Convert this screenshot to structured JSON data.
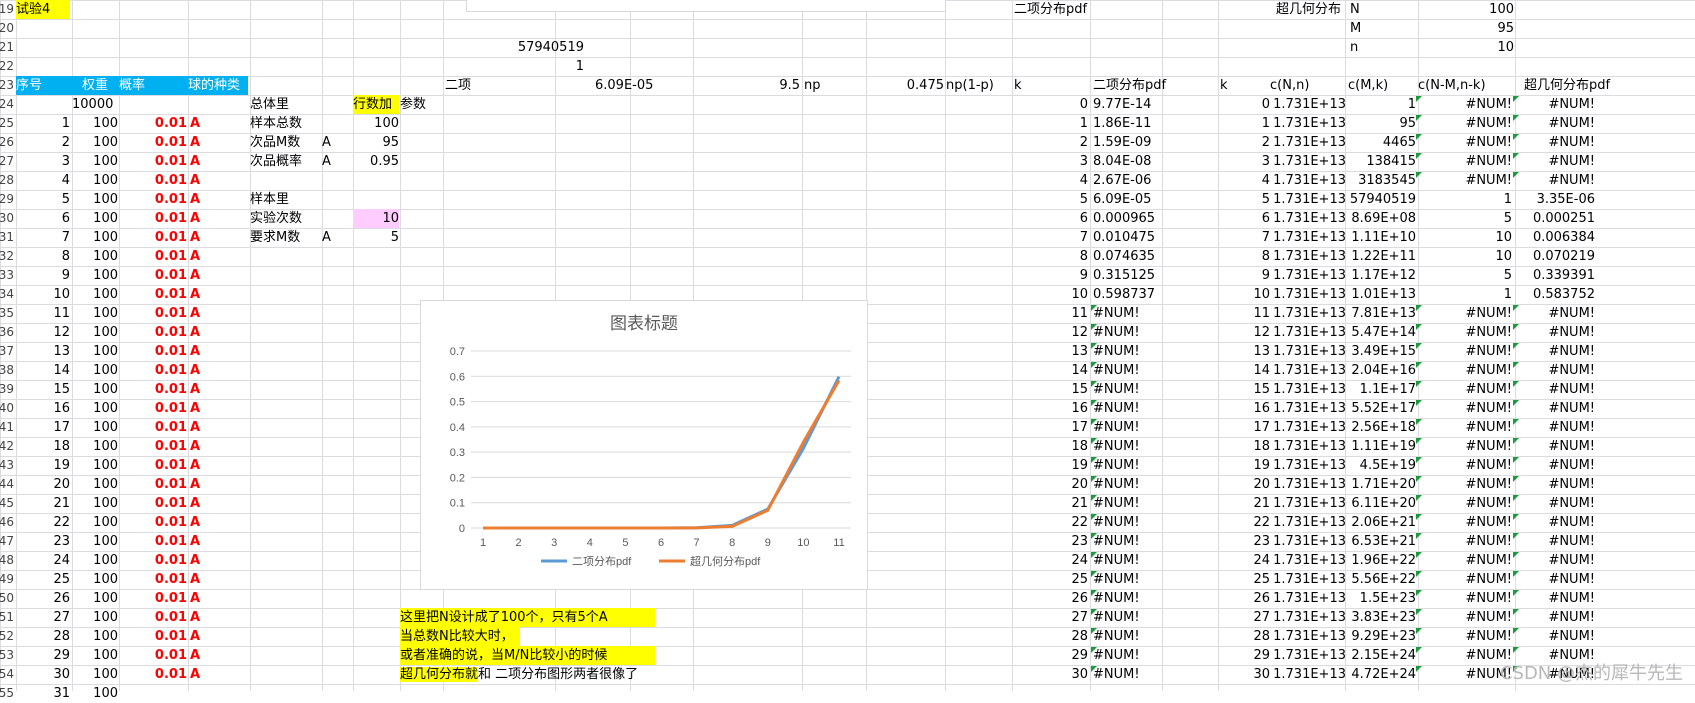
{
  "row_numbers": [
    "19",
    "20",
    "21",
    "22",
    "23",
    "24",
    "25",
    "26",
    "27",
    "28",
    "29",
    "30",
    "31",
    "32",
    "33",
    "34",
    "35",
    "36",
    "37",
    "38",
    "39",
    "40",
    "41",
    "42",
    "43",
    "44",
    "45",
    "46",
    "47",
    "48",
    "49",
    "50",
    "51",
    "52",
    "53",
    "54",
    "55"
  ],
  "title_cell": "试验4",
  "mid_top": {
    "big_number": "57940519",
    "one": "1"
  },
  "header_row": {
    "seq": "序号",
    "weight": "权重",
    "prob": "概率",
    "kind": "球的种类",
    "binom_label": "二项",
    "binom_val": "6.09E-05",
    "np_val": "9.5",
    "np_label": "np",
    "npq_val": "0.475",
    "npq_label": "np(1-p)"
  },
  "left_table": {
    "total_weight": "10000",
    "rows": [
      {
        "n": "1",
        "w": "100",
        "p": "0.01",
        "k": "A"
      },
      {
        "n": "2",
        "w": "100",
        "p": "0.01",
        "k": "A"
      },
      {
        "n": "3",
        "w": "100",
        "p": "0.01",
        "k": "A"
      },
      {
        "n": "4",
        "w": "100",
        "p": "0.01",
        "k": "A"
      },
      {
        "n": "5",
        "w": "100",
        "p": "0.01",
        "k": "A"
      },
      {
        "n": "6",
        "w": "100",
        "p": "0.01",
        "k": "A"
      },
      {
        "n": "7",
        "w": "100",
        "p": "0.01",
        "k": "A"
      },
      {
        "n": "8",
        "w": "100",
        "p": "0.01",
        "k": "A"
      },
      {
        "n": "9",
        "w": "100",
        "p": "0.01",
        "k": "A"
      },
      {
        "n": "10",
        "w": "100",
        "p": "0.01",
        "k": "A"
      },
      {
        "n": "11",
        "w": "100",
        "p": "0.01",
        "k": "A"
      },
      {
        "n": "12",
        "w": "100",
        "p": "0.01",
        "k": "A"
      },
      {
        "n": "13",
        "w": "100",
        "p": "0.01",
        "k": "A"
      },
      {
        "n": "14",
        "w": "100",
        "p": "0.01",
        "k": "A"
      },
      {
        "n": "15",
        "w": "100",
        "p": "0.01",
        "k": "A"
      },
      {
        "n": "16",
        "w": "100",
        "p": "0.01",
        "k": "A"
      },
      {
        "n": "17",
        "w": "100",
        "p": "0.01",
        "k": "A"
      },
      {
        "n": "18",
        "w": "100",
        "p": "0.01",
        "k": "A"
      },
      {
        "n": "19",
        "w": "100",
        "p": "0.01",
        "k": "A"
      },
      {
        "n": "20",
        "w": "100",
        "p": "0.01",
        "k": "A"
      },
      {
        "n": "21",
        "w": "100",
        "p": "0.01",
        "k": "A"
      },
      {
        "n": "22",
        "w": "100",
        "p": "0.01",
        "k": "A"
      },
      {
        "n": "23",
        "w": "100",
        "p": "0.01",
        "k": "A"
      },
      {
        "n": "24",
        "w": "100",
        "p": "0.01",
        "k": "A"
      },
      {
        "n": "25",
        "w": "100",
        "p": "0.01",
        "k": "A"
      },
      {
        "n": "26",
        "w": "100",
        "p": "0.01",
        "k": "A"
      },
      {
        "n": "27",
        "w": "100",
        "p": "0.01",
        "k": "A"
      },
      {
        "n": "28",
        "w": "100",
        "p": "0.01",
        "k": "A"
      },
      {
        "n": "29",
        "w": "100",
        "p": "0.01",
        "k": "A"
      },
      {
        "n": "30",
        "w": "100",
        "p": "0.01",
        "k": "A"
      },
      {
        "n": "31",
        "w": "100",
        "p": "",
        "k": ""
      }
    ]
  },
  "params": {
    "overall": "总体里",
    "add_rows": "行数加",
    "param": "参数",
    "sample_total": "样本总数",
    "sample_total_val": "100",
    "defect_m": "次品M数",
    "defect_m_a": "A",
    "defect_m_val": "95",
    "defect_p": "次品概率",
    "defect_p_a": "A",
    "defect_p_val": "0.95",
    "in_sample": "样本里",
    "trials": "实验次数",
    "trials_val": "10",
    "req_m": "要求M数",
    "req_m_a": "A",
    "req_m_val": "5"
  },
  "notes": [
    "这里把N设计成了100个，只有5个A",
    "当总数N比较大时，",
    "或者准确的说，当M/N比较小的时候",
    "超几何分布就和 二项分布图形两者很像了"
  ],
  "right_top": {
    "binom_pdf": "二项分布pdf",
    "hyper": "超几何分布",
    "N_label": "N",
    "N_val": "100",
    "M_label": "M",
    "M_val": "95",
    "n_label": "n",
    "n_val": "10"
  },
  "right_header": {
    "k": "k",
    "binom": "二项分布pdf",
    "k2": "k",
    "cNn": "c(N,n)",
    "cMk": "c(M,k)",
    "cNM": "c(N-M,n-k)",
    "hyper": "超几何分布pdf"
  },
  "right_rows": [
    {
      "k": "0",
      "b": "9.77E-14",
      "k2": "0",
      "cn": "1.731E+13",
      "cm": "1",
      "cnm": "#NUM!",
      "h": "#NUM!"
    },
    {
      "k": "1",
      "b": "1.86E-11",
      "k2": "1",
      "cn": "1.731E+13",
      "cm": "95",
      "cnm": "#NUM!",
      "h": "#NUM!"
    },
    {
      "k": "2",
      "b": "1.59E-09",
      "k2": "2",
      "cn": "1.731E+13",
      "cm": "4465",
      "cnm": "#NUM!",
      "h": "#NUM!"
    },
    {
      "k": "3",
      "b": "8.04E-08",
      "k2": "3",
      "cn": "1.731E+13",
      "cm": "138415",
      "cnm": "#NUM!",
      "h": "#NUM!"
    },
    {
      "k": "4",
      "b": "2.67E-06",
      "k2": "4",
      "cn": "1.731E+13",
      "cm": "3183545",
      "cnm": "#NUM!",
      "h": "#NUM!"
    },
    {
      "k": "5",
      "b": "6.09E-05",
      "k2": "5",
      "cn": "1.731E+13",
      "cm": "57940519",
      "cnm": "1",
      "h": "3.35E-06"
    },
    {
      "k": "6",
      "b": "0.000965",
      "k2": "6",
      "cn": "1.731E+13",
      "cm": "8.69E+08",
      "cnm": "5",
      "h": "0.000251"
    },
    {
      "k": "7",
      "b": "0.010475",
      "k2": "7",
      "cn": "1.731E+13",
      "cm": "1.11E+10",
      "cnm": "10",
      "h": "0.006384"
    },
    {
      "k": "8",
      "b": "0.074635",
      "k2": "8",
      "cn": "1.731E+13",
      "cm": "1.22E+11",
      "cnm": "10",
      "h": "0.070219"
    },
    {
      "k": "9",
      "b": "0.315125",
      "k2": "9",
      "cn": "1.731E+13",
      "cm": "1.17E+12",
      "cnm": "5",
      "h": "0.339391"
    },
    {
      "k": "10",
      "b": "0.598737",
      "k2": "10",
      "cn": "1.731E+13",
      "cm": "1.01E+13",
      "cnm": "1",
      "h": "0.583752"
    },
    {
      "k": "11",
      "b": "#NUM!",
      "k2": "11",
      "cn": "1.731E+13",
      "cm": "7.81E+13",
      "cnm": "#NUM!",
      "h": "#NUM!"
    },
    {
      "k": "12",
      "b": "#NUM!",
      "k2": "12",
      "cn": "1.731E+13",
      "cm": "5.47E+14",
      "cnm": "#NUM!",
      "h": "#NUM!"
    },
    {
      "k": "13",
      "b": "#NUM!",
      "k2": "13",
      "cn": "1.731E+13",
      "cm": "3.49E+15",
      "cnm": "#NUM!",
      "h": "#NUM!"
    },
    {
      "k": "14",
      "b": "#NUM!",
      "k2": "14",
      "cn": "1.731E+13",
      "cm": "2.04E+16",
      "cnm": "#NUM!",
      "h": "#NUM!"
    },
    {
      "k": "15",
      "b": "#NUM!",
      "k2": "15",
      "cn": "1.731E+13",
      "cm": "1.1E+17",
      "cnm": "#NUM!",
      "h": "#NUM!"
    },
    {
      "k": "16",
      "b": "#NUM!",
      "k2": "16",
      "cn": "1.731E+13",
      "cm": "5.52E+17",
      "cnm": "#NUM!",
      "h": "#NUM!"
    },
    {
      "k": "17",
      "b": "#NUM!",
      "k2": "17",
      "cn": "1.731E+13",
      "cm": "2.56E+18",
      "cnm": "#NUM!",
      "h": "#NUM!"
    },
    {
      "k": "18",
      "b": "#NUM!",
      "k2": "18",
      "cn": "1.731E+13",
      "cm": "1.11E+19",
      "cnm": "#NUM!",
      "h": "#NUM!"
    },
    {
      "k": "19",
      "b": "#NUM!",
      "k2": "19",
      "cn": "1.731E+13",
      "cm": "4.5E+19",
      "cnm": "#NUM!",
      "h": "#NUM!"
    },
    {
      "k": "20",
      "b": "#NUM!",
      "k2": "20",
      "cn": "1.731E+13",
      "cm": "1.71E+20",
      "cnm": "#NUM!",
      "h": "#NUM!"
    },
    {
      "k": "21",
      "b": "#NUM!",
      "k2": "21",
      "cn": "1.731E+13",
      "cm": "6.11E+20",
      "cnm": "#NUM!",
      "h": "#NUM!"
    },
    {
      "k": "22",
      "b": "#NUM!",
      "k2": "22",
      "cn": "1.731E+13",
      "cm": "2.06E+21",
      "cnm": "#NUM!",
      "h": "#NUM!"
    },
    {
      "k": "23",
      "b": "#NUM!",
      "k2": "23",
      "cn": "1.731E+13",
      "cm": "6.53E+21",
      "cnm": "#NUM!",
      "h": "#NUM!"
    },
    {
      "k": "24",
      "b": "#NUM!",
      "k2": "24",
      "cn": "1.731E+13",
      "cm": "1.96E+22",
      "cnm": "#NUM!",
      "h": "#NUM!"
    },
    {
      "k": "25",
      "b": "#NUM!",
      "k2": "25",
      "cn": "1.731E+13",
      "cm": "5.56E+22",
      "cnm": "#NUM!",
      "h": "#NUM!"
    },
    {
      "k": "26",
      "b": "#NUM!",
      "k2": "26",
      "cn": "1.731E+13",
      "cm": "1.5E+23",
      "cnm": "#NUM!",
      "h": "#NUM!"
    },
    {
      "k": "27",
      "b": "#NUM!",
      "k2": "27",
      "cn": "1.731E+13",
      "cm": "3.83E+23",
      "cnm": "#NUM!",
      "h": "#NUM!"
    },
    {
      "k": "28",
      "b": "#NUM!",
      "k2": "28",
      "cn": "1.731E+13",
      "cm": "9.29E+23",
      "cnm": "#NUM!",
      "h": "#NUM!"
    },
    {
      "k": "29",
      "b": "#NUM!",
      "k2": "29",
      "cn": "1.731E+13",
      "cm": "2.15E+24",
      "cnm": "#NUM!",
      "h": "#NUM!"
    },
    {
      "k": "30",
      "b": "#NUM!",
      "k2": "30",
      "cn": "1.731E+13",
      "cm": "4.72E+24",
      "cnm": "#NUM!",
      "h": "#NUM!"
    }
  ],
  "watermark": "CSDN @杰的犀牛先生",
  "chart_data": {
    "type": "line",
    "title": "图表标题",
    "x": [
      "1",
      "2",
      "3",
      "4",
      "5",
      "6",
      "7",
      "8",
      "9",
      "10",
      "11"
    ],
    "ylim": [
      0,
      0.7
    ],
    "yticks": [
      "0",
      "0.1",
      "0.2",
      "0.3",
      "0.4",
      "0.5",
      "0.6",
      "0.7"
    ],
    "grid": true,
    "legend": "bottom",
    "series": [
      {
        "name": "二项分布pdf",
        "color": "#5b9bd5",
        "values": [
          9.77e-14,
          1.86e-11,
          1.59e-09,
          8.04e-08,
          2.67e-06,
          6.09e-05,
          0.000965,
          0.010475,
          0.074635,
          0.315125,
          0.598737
        ]
      },
      {
        "name": "超几何分布pdf",
        "color": "#ed7d31",
        "values": [
          0,
          0,
          0,
          0,
          0,
          3.35e-06,
          0.000251,
          0.006384,
          0.070219,
          0.339391,
          0.583752
        ]
      }
    ]
  }
}
